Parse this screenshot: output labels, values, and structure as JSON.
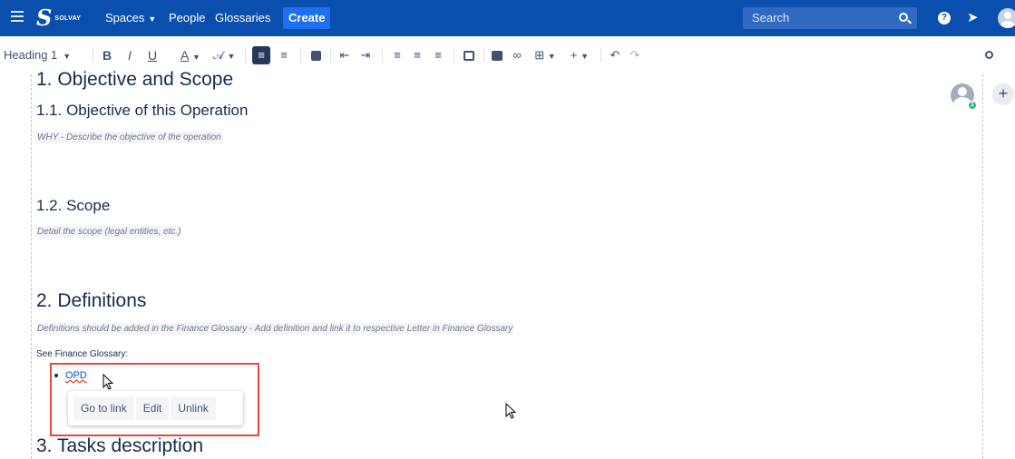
{
  "nav": {
    "brand": "SOLVAY",
    "spaces": "Spaces",
    "people": "People",
    "glossaries": "Glossaries",
    "create": "Create",
    "search_placeholder": "Search",
    "help": "?"
  },
  "toolbar": {
    "style": "Heading 1",
    "bold": "B",
    "italic": "I",
    "underline": "U",
    "text_color": "A",
    "undo": "↶",
    "redo": "↷"
  },
  "doc": {
    "h1_objective": "1. Objective and Scope",
    "h2_objective": "1.1. Objective of this Operation",
    "ph_objective": "WHY - Describe the objective of the operation",
    "h2_scope": "1.2. Scope",
    "ph_scope": "Detail the scope (legal entities, etc.)",
    "h1_definitions": "2. Definitions",
    "ph_definitions": "Definitions should be added in the Finance Glossary - Add definition and link it to respective Letter in Finance Glossary",
    "see_glossary": "See Finance Glossary:",
    "link_text": "OPD",
    "h1_tasks": "3. Tasks description"
  },
  "link_popup": {
    "goto": "Go to link",
    "edit": "Edit",
    "unlink": "Unlink"
  },
  "collab": {
    "count": "1"
  },
  "colors": {
    "nav_bg": "#0b4fae",
    "create_bg": "#1f6ff1",
    "link": "#0052cc",
    "highlight": "#e5483d",
    "presence": "#36b37e"
  }
}
